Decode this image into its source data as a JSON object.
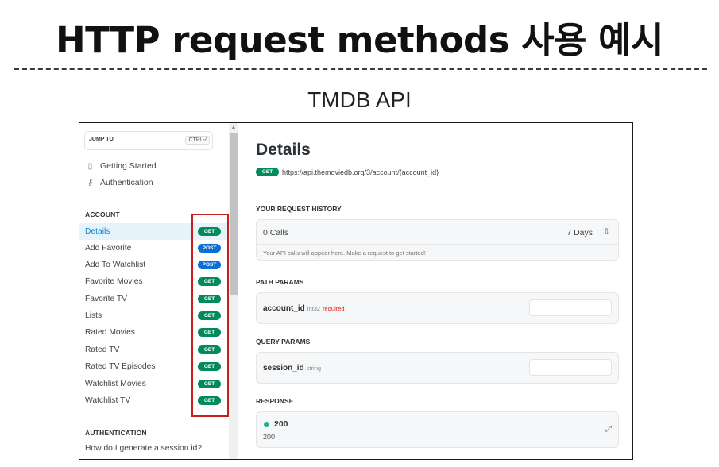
{
  "slide": {
    "title": "HTTP request methods 사용 예시",
    "subtitle": "TMDB API"
  },
  "sidebar": {
    "jump_label": "JUMP TO",
    "jump_shortcut": "CTRL-/",
    "guides": [
      {
        "label": "Getting Started",
        "icon": "book-icon"
      },
      {
        "label": "Authentication",
        "icon": "key-icon"
      }
    ],
    "account_section": "ACCOUNT",
    "items": [
      {
        "label": "Details",
        "method": "GET",
        "active": true
      },
      {
        "label": "Add Favorite",
        "method": "POST"
      },
      {
        "label": "Add To Watchlist",
        "method": "POST"
      },
      {
        "label": "Favorite Movies",
        "method": "GET"
      },
      {
        "label": "Favorite TV",
        "method": "GET"
      },
      {
        "label": "Lists",
        "method": "GET"
      },
      {
        "label": "Rated Movies",
        "method": "GET"
      },
      {
        "label": "Rated TV",
        "method": "GET"
      },
      {
        "label": "Rated TV Episodes",
        "method": "GET"
      },
      {
        "label": "Watchlist Movies",
        "method": "GET"
      },
      {
        "label": "Watchlist TV",
        "method": "GET"
      }
    ],
    "auth_section": "AUTHENTICATION",
    "auth_item": "How do I generate a session id?"
  },
  "main": {
    "title": "Details",
    "method": "GET",
    "url_prefix": "https://api.themoviedb.org/3/account/{",
    "url_param": "account_id",
    "url_suffix": "}",
    "history_label": "YOUR REQUEST HISTORY",
    "calls": "0 Calls",
    "period": "7 Days",
    "history_note": "Your API calls will appear here. Make a request to get started!",
    "path_params_label": "PATH PARAMS",
    "path_param": {
      "name": "account_id",
      "type": "int32",
      "required": "required"
    },
    "query_params_label": "QUERY PARAMS",
    "query_param": {
      "name": "session_id",
      "type": "string"
    },
    "response_label": "RESPONSE",
    "response_code": "200",
    "response_sub": "200"
  },
  "colors": {
    "get_badge": "#018a5b",
    "post_badge": "#0a6fd6",
    "active_item": "#1587d1",
    "highlight_box": "#c81e1e",
    "status_dot": "#12b886"
  }
}
